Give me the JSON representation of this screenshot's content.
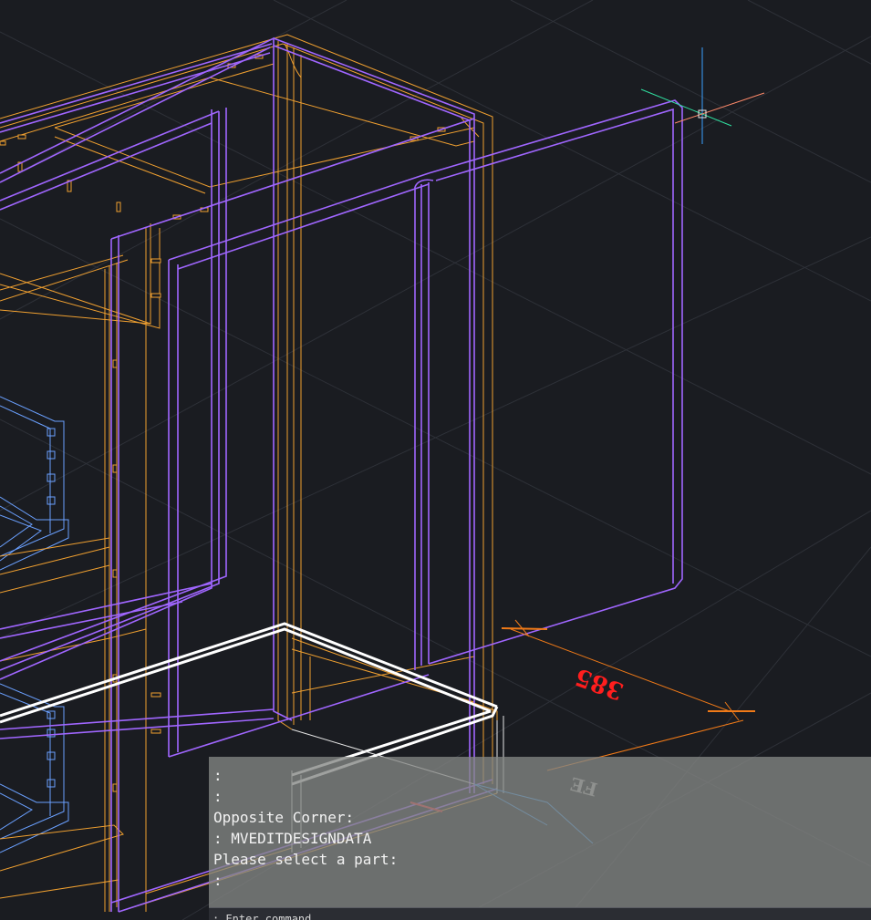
{
  "colors": {
    "background": "#1a1c21",
    "grid": "#2e3138",
    "cabinet_frame": "#f0a030",
    "panel": "#a066ff",
    "drawer": "#6aa0ff",
    "selection": "#ffffff",
    "dimension": "#f07a18",
    "dimension_text": "#ff1e1e",
    "crosshair_x": "#ff8a6a",
    "crosshair_y": "#3aa0ff",
    "crosshair_z": "#30e0a0",
    "command_panel_bg": "#848684",
    "command_text": "#f2f2f2"
  },
  "icons": {
    "cursor": "crosshair-cursor-icon",
    "ucs": "ucs-axis-icon"
  },
  "viewport": {
    "dimension_label": "385",
    "mirror_label": "FE"
  },
  "command_line": {
    "history": [
      ":",
      ":",
      "Opposite Corner:",
      ": MVEDITDESIGNDATA",
      "Please select a part:",
      ":"
    ],
    "input_prompt": ": Enter command"
  }
}
